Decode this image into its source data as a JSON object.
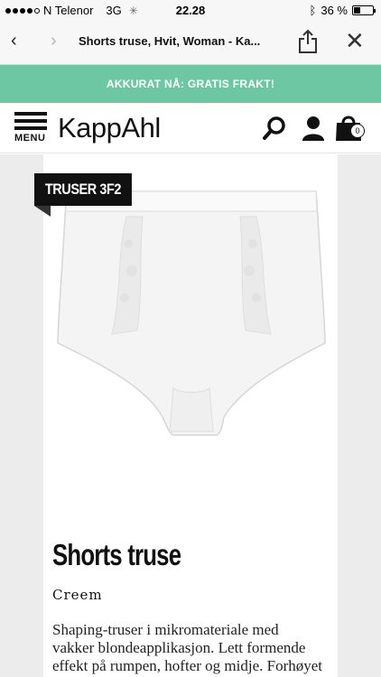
{
  "status_bar": {
    "carrier": "N Telenor",
    "network": "3G",
    "time": "22.28",
    "battery": "36 %",
    "battery_level": 0.36
  },
  "browser": {
    "title": "Shorts truse, Hvit, Woman - Ka..."
  },
  "promo": {
    "text": "AKKURAT NÅ: GRATIS FRAKT!"
  },
  "header": {
    "menu_label": "MENU",
    "logo": "KappAhl",
    "cart_count": "0"
  },
  "product": {
    "tag": "TRUSER 3F2",
    "name": "Shorts truse",
    "color": "Creem",
    "description": "Shaping-truser i mikromateriale med vakker blondeapplikasjon. Lett formende effekt på rumpen, hofter og midje. Forhøyet liv med stadig"
  },
  "colors": {
    "promo_bg": "#6cc7a2",
    "page_bg": "#ececec",
    "tag_bg": "#111111"
  }
}
